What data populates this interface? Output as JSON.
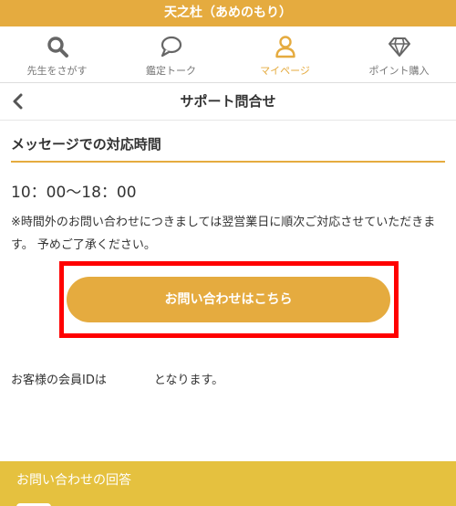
{
  "app": {
    "title": "天之杜（あめのもり）"
  },
  "nav": {
    "items": [
      {
        "label": "先生をさがす",
        "icon": "search-icon"
      },
      {
        "label": "鑑定トーク",
        "icon": "speech-bubble-icon"
      },
      {
        "label": "マイページ",
        "icon": "person-icon",
        "active": true
      },
      {
        "label": "ポイント購入",
        "icon": "diamond-icon"
      }
    ]
  },
  "page": {
    "title": "サポート問合せ"
  },
  "section": {
    "title": "メッセージでの対応時間"
  },
  "hours": "10：00〜18：00",
  "note": "※時間外のお問い合わせにつきましては翌営業日に順次ご対応させていただきます。 予めご了承ください。",
  "contact_button": {
    "label": "お問い合わせはこちら"
  },
  "member": {
    "prefix": "お客様の会員IDは",
    "suffix": "となります。"
  },
  "answers": {
    "title": "お問い合わせの回答"
  },
  "colors": {
    "accent": "#e5ab3f",
    "answer_bar": "#e5c13f",
    "highlight": "#ff0000"
  }
}
